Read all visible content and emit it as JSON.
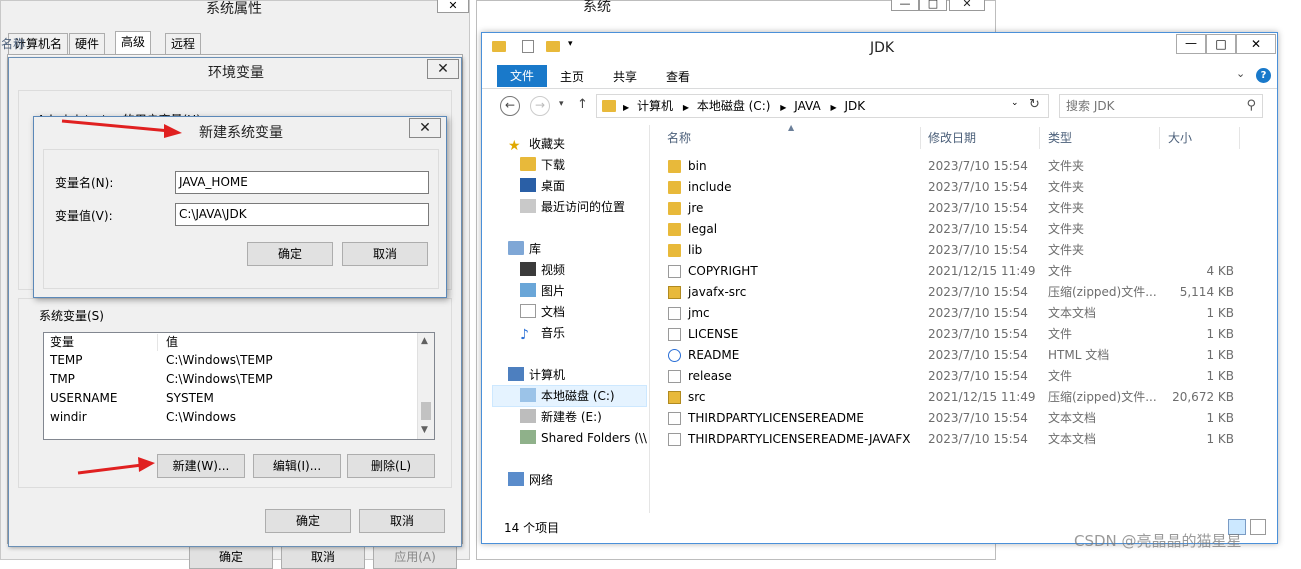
{
  "sysprops": {
    "title": "系统属性",
    "tabs": [
      "计算机名",
      "硬件",
      "高级",
      "远程"
    ],
    "bottom_buttons": [
      "确定",
      "取消",
      "应用(A)"
    ]
  },
  "envvars": {
    "title": "环境变量",
    "user_section_label": "Administrator 的用户变量(U)",
    "system_section_label": "系统变量(S)",
    "columns": [
      "变量",
      "值"
    ],
    "rows": [
      {
        "name": "TEMP",
        "value": "C:\\Windows\\TEMP"
      },
      {
        "name": "TMP",
        "value": "C:\\Windows\\TEMP"
      },
      {
        "name": "USERNAME",
        "value": "SYSTEM"
      },
      {
        "name": "windir",
        "value": "C:\\Windows"
      }
    ],
    "new_button": "新建(W)...",
    "edit_button": "编辑(I)...",
    "delete_button": "删除(L)",
    "ok_button": "确定",
    "cancel_button": "取消"
  },
  "newvar": {
    "title": "新建系统变量",
    "name_label": "变量名(N):",
    "name_value": "JAVA_HOME",
    "value_label": "变量值(V):",
    "value_value": "C:\\JAVA\\JDK",
    "ok_button": "确定",
    "cancel_button": "取消"
  },
  "system_window": {
    "title": "系统"
  },
  "explorer": {
    "title": "JDK",
    "ribbon_tabs": [
      "文件",
      "主页",
      "共享",
      "查看"
    ],
    "breadcrumb": [
      "计算机",
      "本地磁盘 (C:)",
      "JAVA",
      "JDK"
    ],
    "search_placeholder": "搜索 JDK",
    "columns": {
      "name": "名称",
      "date": "修改日期",
      "type": "类型",
      "size": "大小"
    },
    "nav": [
      {
        "label": "收藏夹",
        "icon": "star-icon"
      },
      {
        "label": "下载",
        "icon": "download-folder-icon"
      },
      {
        "label": "桌面",
        "icon": "desktop-icon"
      },
      {
        "label": "最近访问的位置",
        "icon": "recent-places-icon"
      },
      {
        "label": "库",
        "icon": "library-icon"
      },
      {
        "label": "视频",
        "icon": "video-icon"
      },
      {
        "label": "图片",
        "icon": "picture-icon"
      },
      {
        "label": "文档",
        "icon": "document-icon"
      },
      {
        "label": "音乐",
        "icon": "music-icon"
      },
      {
        "label": "计算机",
        "icon": "computer-icon"
      },
      {
        "label": "本地磁盘 (C:)",
        "icon": "drive-icon"
      },
      {
        "label": "新建卷 (E:)",
        "icon": "drive-icon"
      },
      {
        "label": "Shared Folders (\\\\",
        "icon": "shared-folder-icon"
      },
      {
        "label": "网络",
        "icon": "network-icon"
      }
    ],
    "files": [
      {
        "name": "bin",
        "date": "2023/7/10 15:54",
        "type": "文件夹",
        "size": "",
        "icon": "folder-icon"
      },
      {
        "name": "include",
        "date": "2023/7/10 15:54",
        "type": "文件夹",
        "size": "",
        "icon": "folder-icon"
      },
      {
        "name": "jre",
        "date": "2023/7/10 15:54",
        "type": "文件夹",
        "size": "",
        "icon": "folder-icon"
      },
      {
        "name": "legal",
        "date": "2023/7/10 15:54",
        "type": "文件夹",
        "size": "",
        "icon": "folder-icon"
      },
      {
        "name": "lib",
        "date": "2023/7/10 15:54",
        "type": "文件夹",
        "size": "",
        "icon": "folder-icon"
      },
      {
        "name": "COPYRIGHT",
        "date": "2021/12/15 11:49",
        "type": "文件",
        "size": "4 KB",
        "icon": "file-icon"
      },
      {
        "name": "javafx-src",
        "date": "2023/7/10 15:54",
        "type": "压缩(zipped)文件...",
        "size": "5,114 KB",
        "icon": "zip-icon"
      },
      {
        "name": "jmc",
        "date": "2023/7/10 15:54",
        "type": "文本文档",
        "size": "1 KB",
        "icon": "text-file-icon"
      },
      {
        "name": "LICENSE",
        "date": "2023/7/10 15:54",
        "type": "文件",
        "size": "1 KB",
        "icon": "file-icon"
      },
      {
        "name": "README",
        "date": "2023/7/10 15:54",
        "type": "HTML 文档",
        "size": "1 KB",
        "icon": "html-file-icon"
      },
      {
        "name": "release",
        "date": "2023/7/10 15:54",
        "type": "文件",
        "size": "1 KB",
        "icon": "file-icon"
      },
      {
        "name": "src",
        "date": "2021/12/15 11:49",
        "type": "压缩(zipped)文件...",
        "size": "20,672 KB",
        "icon": "zip-icon"
      },
      {
        "name": "THIRDPARTYLICENSEREADME",
        "date": "2023/7/10 15:54",
        "type": "文本文档",
        "size": "1 KB",
        "icon": "text-file-icon"
      },
      {
        "name": "THIRDPARTYLICENSEREADME-JAVAFX",
        "date": "2023/7/10 15:54",
        "type": "文本文档",
        "size": "1 KB",
        "icon": "text-file-icon"
      }
    ],
    "status": "14 个项目"
  },
  "watermark": "CSDN @亮晶晶的猫星星",
  "colors": {
    "accent": "#1979ca",
    "selection": "#cce8ff",
    "arrow": "#e02020",
    "dialog_bg": "#f0f0f0"
  }
}
